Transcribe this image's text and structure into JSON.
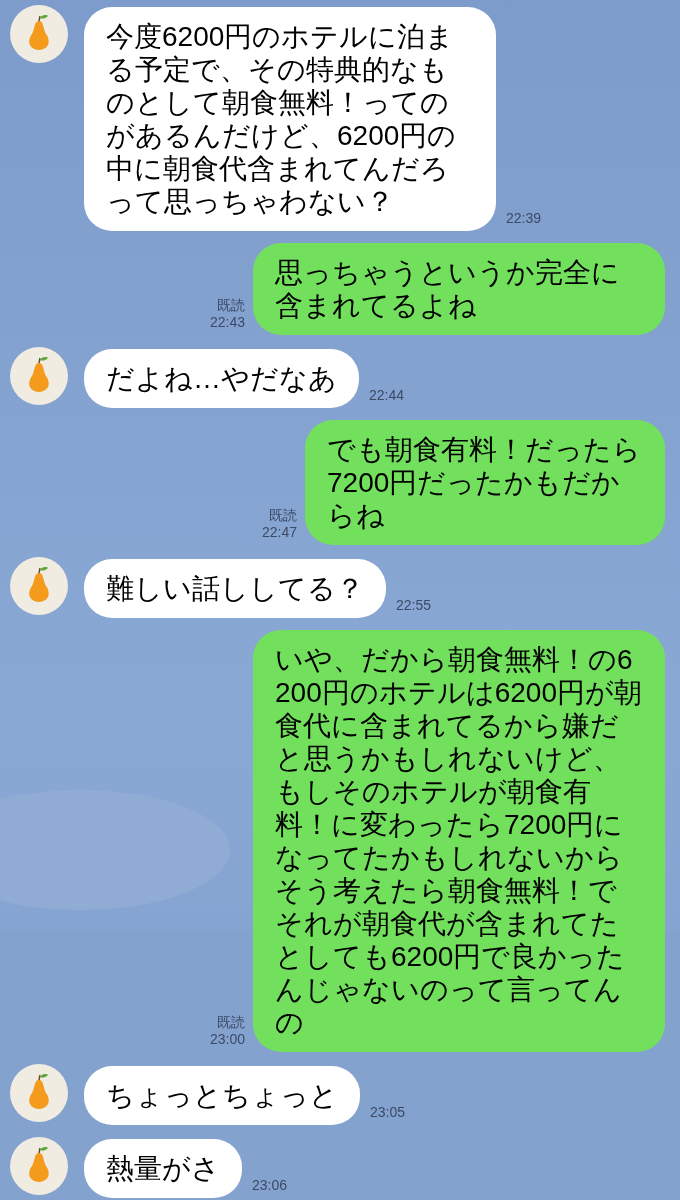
{
  "messages": [
    {
      "kind": "incoming",
      "text": "今度6200円のホテルに泊まる予定で、その特典的なものとして朝食無料！ってのがあるんだけど、6200円の中に朝食代含まれてんだろって思っちゃわない？",
      "time": "22:39"
    },
    {
      "kind": "outgoing",
      "text": "思っちゃうというか完全に含まれてるよね",
      "read_label": "既読",
      "time": "22:43"
    },
    {
      "kind": "incoming",
      "text": "だよね…やだなあ",
      "time": "22:44"
    },
    {
      "kind": "outgoing",
      "text": "でも朝食有料！だったら7200円だったかもだからね",
      "read_label": "既読",
      "time": "22:47"
    },
    {
      "kind": "incoming",
      "text": "難しい話ししてる？",
      "time": "22:55"
    },
    {
      "kind": "outgoing",
      "text": "いや、だから朝食無料！の6200円のホテルは6200円が朝食代に含まれてるから嫌だと思うかもしれないけど、もしそのホテルが朝食有料！に変わったら7200円になってたかもしれないからそう考えたら朝食無料！でそれが朝食代が含まれてたとしても6200円で良かったんじゃないのって言ってんの",
      "read_label": "既読",
      "time": "23:00"
    },
    {
      "kind": "incoming",
      "text": "ちょっとちょっと",
      "time": "23:05"
    },
    {
      "kind": "incoming",
      "text": "熱量がさ",
      "time": "23:06"
    }
  ]
}
